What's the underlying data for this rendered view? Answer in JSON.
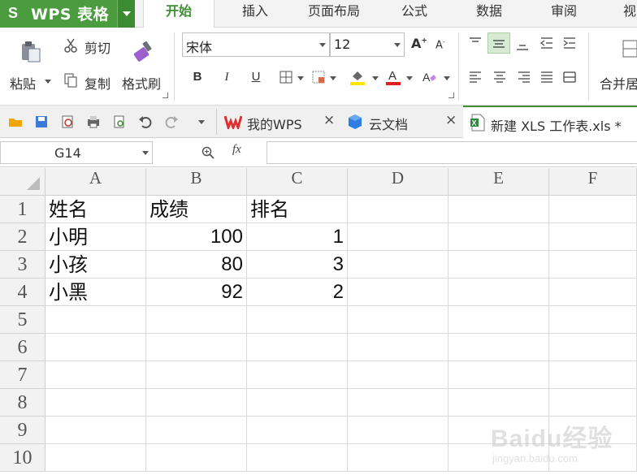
{
  "app": {
    "logo_glyph": "S",
    "name": "WPS 表格",
    "accent": "#4a9c3e"
  },
  "menu": [
    {
      "label": "开始",
      "active": true
    },
    {
      "label": "插入"
    },
    {
      "label": "页面布局"
    },
    {
      "label": "公式"
    },
    {
      "label": "数据"
    },
    {
      "label": "审阅"
    },
    {
      "label": "视"
    }
  ],
  "ribbon": {
    "paste": "粘贴",
    "cut": "剪切",
    "copy": "复制",
    "format_painter": "格式刷",
    "font_name": "宋体",
    "font_size": "12",
    "bold": "B",
    "italic": "I",
    "underline": "U",
    "merge": "合并居"
  },
  "doc_tabs": [
    {
      "label": "我的WPS",
      "close": "×"
    },
    {
      "label": "云文档",
      "close": "×"
    },
    {
      "label": "新建 XLS 工作表.xls *",
      "active": true
    }
  ],
  "formula_bar": {
    "name_box": "G14",
    "fx": "fx",
    "formula": ""
  },
  "sheet": {
    "columns": [
      "A",
      "B",
      "C",
      "D",
      "E",
      "F"
    ],
    "row_numbers": [
      "1",
      "2",
      "3",
      "4",
      "5",
      "6",
      "7",
      "8",
      "9",
      "10"
    ],
    "rows": [
      [
        "姓名",
        "成绩",
        "排名"
      ],
      [
        "小明",
        "100",
        "1"
      ],
      [
        "小孩",
        "80",
        "3"
      ],
      [
        "小黑",
        "92",
        "2"
      ]
    ]
  },
  "watermark": {
    "brand": "Baidu经验",
    "url": "jingyan.baidu.com"
  }
}
